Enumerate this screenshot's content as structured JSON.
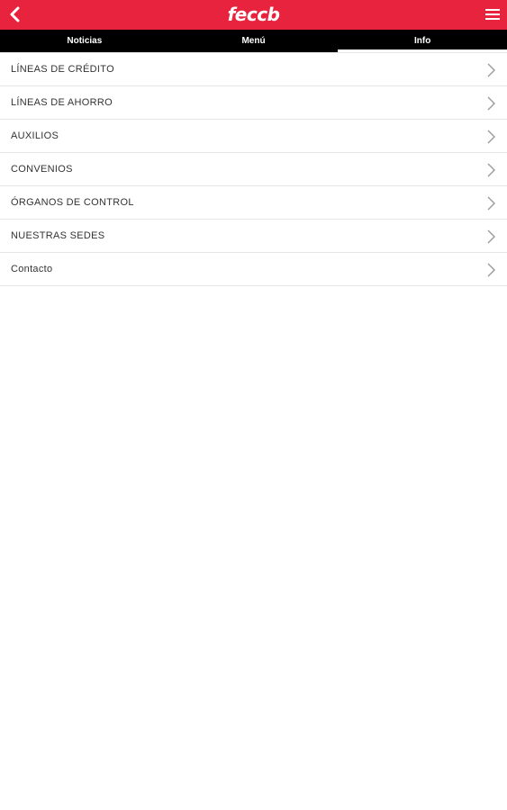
{
  "header": {
    "logo_text": "feccb",
    "back_icon": "chevron-left-icon",
    "menu_icon": "hamburger-menu-icon",
    "brand_color": "#e8233d"
  },
  "tabs": [
    {
      "label": "Noticias",
      "active": false
    },
    {
      "label": "Menú",
      "active": false
    },
    {
      "label": "Info",
      "active": true
    }
  ],
  "menu": {
    "items": [
      {
        "label": "LÍNEAS DE CRÉDITO"
      },
      {
        "label": "LÍNEAS DE AHORRO"
      },
      {
        "label": "AUXILIOS"
      },
      {
        "label": "CONVENIOS"
      },
      {
        "label": "ÓRGANOS DE CONTROL"
      },
      {
        "label": "NUESTRAS SEDES"
      },
      {
        "label": "Contacto"
      }
    ]
  }
}
